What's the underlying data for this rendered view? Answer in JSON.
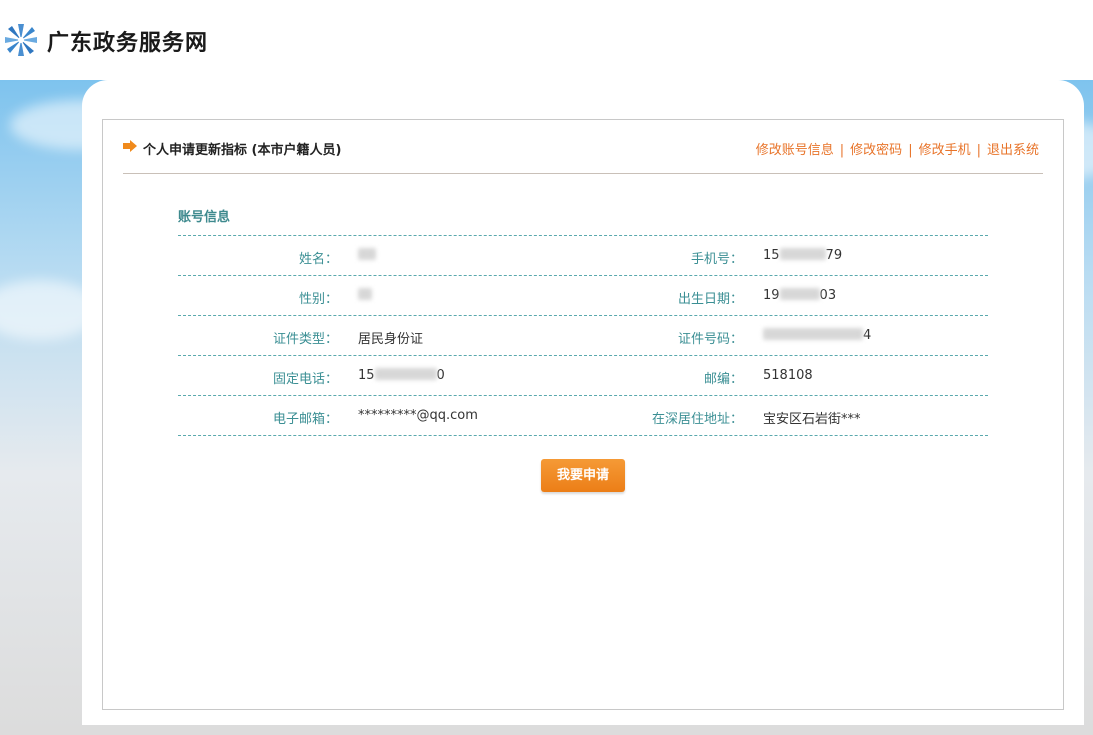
{
  "header": {
    "site_title": "广东政务服务网",
    "logo_icon": "gd-gov-pinwheel-icon"
  },
  "panel": {
    "title": "个人申请更新指标 (本市户籍人员)",
    "title_icon": "orange-arrow-icon",
    "links": [
      {
        "label": "修改账号信息"
      },
      {
        "label": "修改密码"
      },
      {
        "label": "修改手机"
      },
      {
        "label": "退出系统"
      }
    ],
    "separator": "|"
  },
  "account": {
    "section_title": "账号信息",
    "rows": [
      {
        "left_label": "姓名：",
        "left_value": "",
        "right_label": "手机号：",
        "right_prefix": "15",
        "right_suffix": "79"
      },
      {
        "left_label": "性别：",
        "left_value": "",
        "right_label": "出生日期：",
        "right_prefix": "19",
        "right_suffix": "03"
      },
      {
        "left_label": "证件类型：",
        "left_value": "居民身份证",
        "right_label": "证件号码：",
        "right_prefix": "",
        "right_suffix": "4"
      },
      {
        "left_label": "固定电话：",
        "left_value": "15",
        "left_suffix": "0",
        "right_label": "邮编：",
        "right_prefix": "518108",
        "right_suffix": ""
      },
      {
        "left_label": "电子邮箱：",
        "left_value": "*********@qq.com",
        "right_label": "在深居住地址：",
        "right_prefix": "宝安区石岩街***",
        "right_suffix": ""
      }
    ]
  },
  "actions": {
    "apply_label": "我要申请"
  },
  "colors": {
    "accent": "#ec7e17",
    "label": "#3b8f94",
    "link": "#e8742a"
  }
}
